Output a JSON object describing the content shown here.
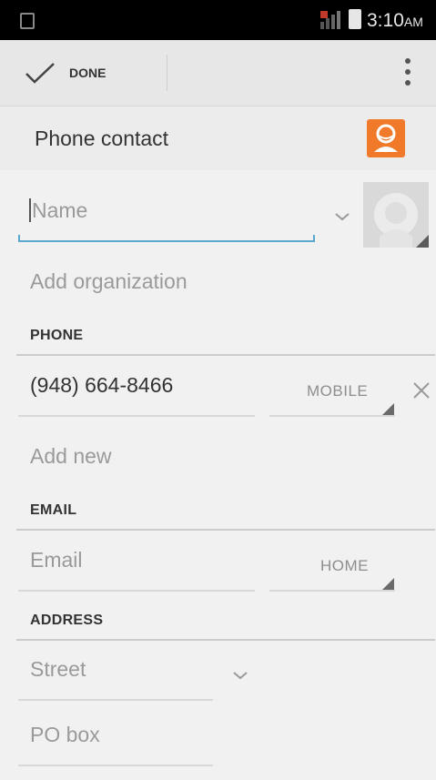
{
  "status_bar": {
    "time": "3:10",
    "ampm": "AM"
  },
  "action_bar": {
    "done_label": "DONE"
  },
  "header": {
    "title": "Phone contact"
  },
  "colors": {
    "accent_orange": "#f07a2a",
    "focus_blue": "#5aa8d0"
  },
  "form": {
    "name_placeholder": "Name",
    "organization_link": "Add organization",
    "phone": {
      "section_title": "PHONE",
      "number": "(948) 664-8466",
      "type": "MOBILE",
      "add_new": "Add new"
    },
    "email": {
      "section_title": "EMAIL",
      "placeholder": "Email",
      "type": "HOME"
    },
    "address": {
      "section_title": "ADDRESS",
      "street_placeholder": "Street",
      "pobox_placeholder": "PO box"
    }
  },
  "icons": {
    "check": "check-icon",
    "overflow": "overflow-menu-icon",
    "contact_badge": "contact-account-icon",
    "photo": "contact-photo-icon",
    "remove": "close-icon"
  }
}
